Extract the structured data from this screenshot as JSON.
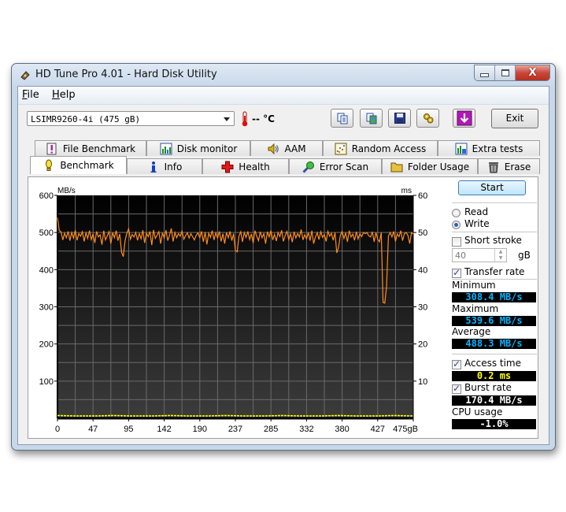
{
  "window": {
    "title": "HD Tune Pro 4.01 - Hard Disk Utility",
    "controls": {
      "minimize": "minimize-icon",
      "maximize": "maximize-icon",
      "close": "close-icon"
    }
  },
  "menu": {
    "items": [
      {
        "label": "File",
        "accel": "F"
      },
      {
        "label": "Help",
        "accel": "H"
      }
    ]
  },
  "toolbar": {
    "drive_select": "LSIMR9260-4i (475 gB)",
    "temperature": "-- °C",
    "icon_buttons": [
      "copy-text-icon",
      "copy-screenshot-icon",
      "save-icon",
      "options-icon",
      "download-icon"
    ],
    "exit_label": "Exit"
  },
  "tabs": {
    "row1": [
      {
        "label": "File Benchmark",
        "icon": "file-benchmark-icon"
      },
      {
        "label": "Disk monitor",
        "icon": "disk-monitor-icon"
      },
      {
        "label": "AAM",
        "icon": "speaker-icon"
      },
      {
        "label": "Random Access",
        "icon": "random-access-icon"
      },
      {
        "label": "Extra tests",
        "icon": "extra-tests-icon"
      }
    ],
    "row2": [
      {
        "label": "Benchmark",
        "icon": "benchmark-icon",
        "active": true
      },
      {
        "label": "Info",
        "icon": "info-icon"
      },
      {
        "label": "Health",
        "icon": "health-icon"
      },
      {
        "label": "Error Scan",
        "icon": "magnifier-icon"
      },
      {
        "label": "Folder Usage",
        "icon": "folder-icon"
      },
      {
        "label": "Erase",
        "icon": "trash-icon"
      }
    ]
  },
  "side": {
    "start_label": "Start",
    "mode_read": "Read",
    "mode_write": "Write",
    "mode_selected": "write",
    "short_stroke_label": "Short stroke",
    "short_stroke_checked": false,
    "short_stroke_value": "40",
    "short_stroke_unit": "gB",
    "transfer_rate_label": "Transfer rate",
    "transfer_rate_checked": true,
    "minimum_label": "Minimum",
    "minimum_value": "308.4 MB/s",
    "maximum_label": "Maximum",
    "maximum_value": "539.6 MB/s",
    "average_label": "Average",
    "average_value": "488.3 MB/s",
    "access_time_label": "Access time",
    "access_time_checked": true,
    "access_time_value": "0.2 ms",
    "burst_rate_label": "Burst rate",
    "burst_rate_checked": true,
    "burst_rate_value": "170.4 MB/s",
    "cpu_usage_label": "CPU usage",
    "cpu_usage_value": "-1.0%",
    "colors": {
      "transfer": "#00b4ff",
      "access": "#ffff00",
      "burst": "#ffffff"
    }
  },
  "chart_data": {
    "type": "line",
    "ylabel_left": "MB/s",
    "ylabel_right": "ms",
    "xlabel_unit": "gB",
    "x_ticks": [
      "0",
      "47",
      "95",
      "142",
      "190",
      "237",
      "285",
      "332",
      "380",
      "427",
      "475gB"
    ],
    "y_left_ticks": [
      "600",
      "500",
      "400",
      "300",
      "200",
      "100"
    ],
    "y_right_ticks": [
      "60",
      "50",
      "40",
      "30",
      "20",
      "10"
    ],
    "xlim": [
      0,
      475
    ],
    "ylim_left": [
      0,
      600
    ],
    "ylim_right": [
      0,
      60
    ],
    "grid": true,
    "series": [
      {
        "name": "Transfer rate",
        "color": "#ff8c1a",
        "axis": "left",
        "x_step_gb": 2.375,
        "values": [
          540,
          505,
          502,
          480,
          498,
          486,
          503,
          478,
          500,
          485,
          506,
          479,
          497,
          490,
          502,
          476,
          499,
          484,
          505,
          481,
          496,
          472,
          503,
          488,
          494,
          467,
          505,
          480,
          491,
          502,
          470,
          500,
          486,
          505,
          478,
          496,
          447,
          435,
          478,
          498,
          510,
          482,
          495,
          488,
          500,
          479,
          497,
          483,
          506,
          472,
          498,
          489,
          503,
          466,
          507,
          484,
          493,
          502,
          470,
          499,
          485,
          506,
          478,
          493,
          511,
          476,
          500,
          486,
          497,
          490,
          504,
          482,
          491,
          499,
          485,
          497,
          488,
          480,
          493,
          499,
          486,
          503,
          475,
          501,
          468,
          498,
          487,
          505,
          480,
          499,
          485,
          503,
          476,
          497,
          470,
          500,
          486,
          503,
          478,
          497,
          452,
          448,
          490,
          502,
          475,
          500,
          487,
          503,
          481,
          496,
          472,
          505,
          490,
          478,
          502,
          486,
          497,
          470,
          502,
          488,
          505,
          480,
          495,
          477,
          500,
          489,
          506,
          476,
          492,
          503,
          481,
          496,
          474,
          502,
          485,
          497,
          488,
          508,
          480,
          494,
          483,
          500,
          478,
          505,
          470,
          488,
          499,
          481,
          502,
          487,
          495,
          476,
          503,
          490,
          498,
          479,
          500,
          445,
          460,
          492,
          503,
          484,
          499,
          475,
          505,
          488,
          496,
          479,
          502,
          483,
          497,
          489,
          500,
          497,
          500,
          491,
          488,
          502,
          475,
          500,
          482,
          475,
          500,
          312,
          310,
          356,
          490,
          500,
          488,
          503,
          476,
          496,
          489,
          505,
          478,
          497,
          500,
          492,
          470,
          500,
          496
        ]
      },
      {
        "name": "Access time",
        "color": "#ffff00",
        "axis": "right",
        "values": [
          0.2,
          0.2,
          0.2,
          0.2,
          0.2,
          0.2,
          0.2,
          0.2,
          0.2,
          0.2,
          0.2,
          0.2,
          0.2,
          0.2,
          0.2,
          0.2,
          0.2,
          0.2,
          0.2,
          0.2
        ]
      }
    ]
  }
}
